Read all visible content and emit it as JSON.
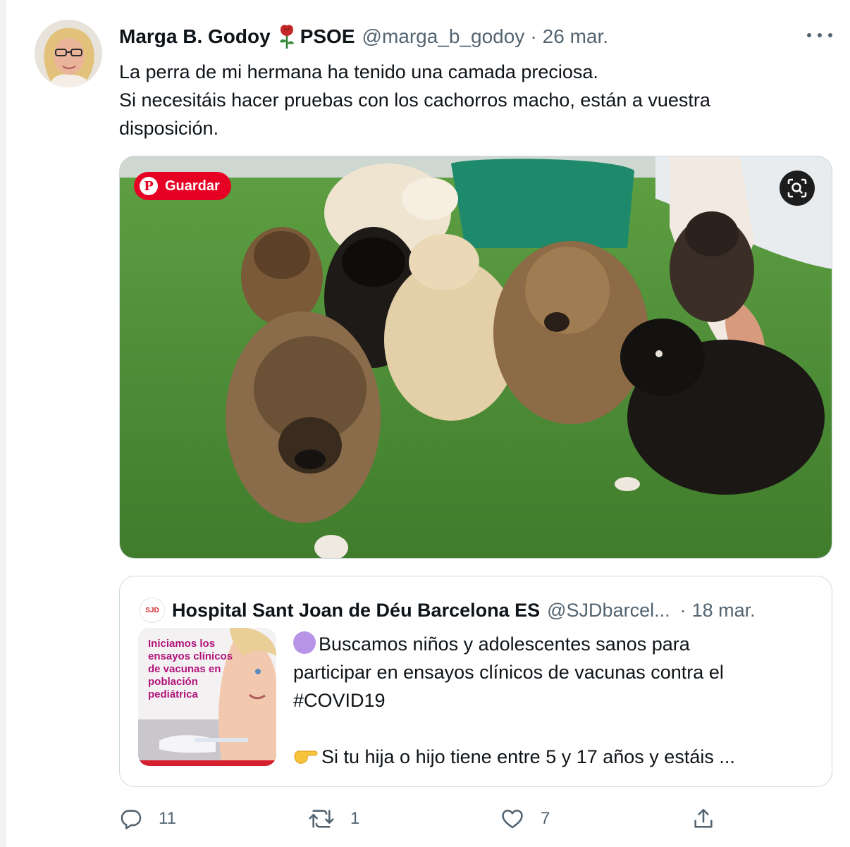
{
  "tweet": {
    "author_name": "Marga B. Godoy",
    "author_suffix": "PSOE",
    "handle": "@marga_b_godoy",
    "separator": "·",
    "date": "26 mar.",
    "text_lines": [
      "La perra de mi hermana ha tenido una camada preciosa.",
      "Si necesitáis hacer pruebas con los cachorros macho, están a vuestra",
      "disposición."
    ],
    "media": {
      "save_label": "Guardar",
      "save_icon": "pinterest-icon",
      "lens_icon": "visual-search-icon"
    }
  },
  "quote": {
    "author_name": "Hospital Sant Joan de Déu Barcelona ES",
    "handle": "@SJDbarcel...",
    "separator": "·",
    "date": "18 mar.",
    "logo_text": "SJD",
    "thumb_text": "Iniciamos los ensayos clínicos de vacunas en población pediátrica",
    "text_lines": [
      "Buscamos niños y adolescentes sanos para",
      "participar en ensayos clínicos de vacunas contra el",
      "#COVID19",
      "",
      "Si tu hija o hijo tiene entre 5 y 17 años y estáis ..."
    ]
  },
  "actions": {
    "reply_count": "11",
    "retweet_count": "1",
    "like_count": "7"
  },
  "colors": {
    "accent_text": "#536471",
    "pinterest": "#e60023",
    "border": "#cfd9de"
  }
}
